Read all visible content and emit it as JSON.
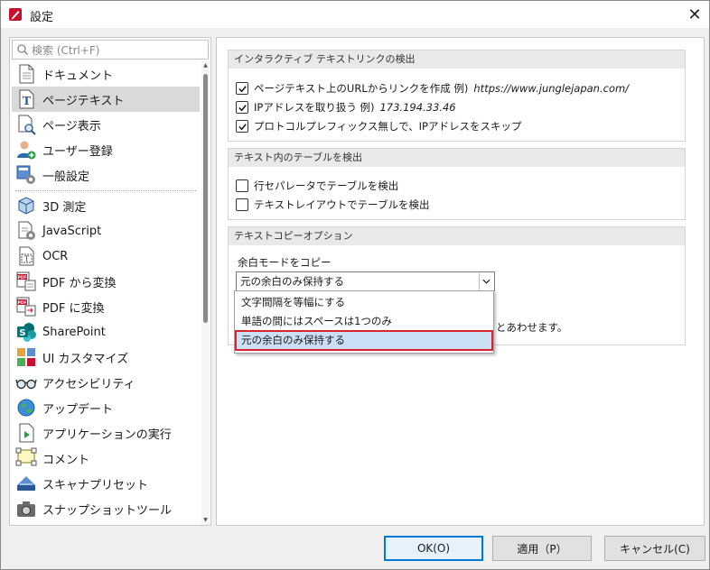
{
  "window": {
    "title": "設定",
    "close_glyph": "✕"
  },
  "search": {
    "placeholder": "検索 (Ctrl+F)"
  },
  "nav": {
    "items": [
      {
        "label": "ドキュメント",
        "icon": "document-icon"
      },
      {
        "label": "ページテキスト",
        "icon": "text-icon",
        "selected": true
      },
      {
        "label": "ページ表示",
        "icon": "page-view-icon"
      },
      {
        "label": "ユーザー登録",
        "icon": "user-add-icon"
      },
      {
        "label": "一般設定",
        "icon": "general-settings-icon"
      },
      {
        "label": "3D 測定",
        "icon": "cube-icon"
      },
      {
        "label": "JavaScript",
        "icon": "script-gear-icon"
      },
      {
        "label": "OCR",
        "icon": "ocr-icon"
      },
      {
        "label": "PDF から変換",
        "icon": "pdf-convert-from-icon"
      },
      {
        "label": "PDF に変換",
        "icon": "pdf-convert-to-icon"
      },
      {
        "label": "SharePoint",
        "icon": "sharepoint-icon"
      },
      {
        "label": "UI カスタマイズ",
        "icon": "ui-customize-icon"
      },
      {
        "label": "アクセシビリティ",
        "icon": "glasses-icon"
      },
      {
        "label": "アップデート",
        "icon": "globe-icon"
      },
      {
        "label": "アプリケーションの実行",
        "icon": "app-run-icon"
      },
      {
        "label": "コメント",
        "icon": "comment-icon"
      },
      {
        "label": "スキャナプリセット",
        "icon": "scanner-icon"
      },
      {
        "label": "スナップショットツール",
        "icon": "camera-icon"
      }
    ]
  },
  "groups": {
    "links": {
      "header": "インタラクティブ テキストリンクの検出",
      "options": [
        {
          "label": "ページテキスト上のURLからリンクを作成  例)",
          "example": "https://www.junglejapan.com/",
          "checked": true
        },
        {
          "label": "IPアドレスを取り扱う 例)",
          "example": "173.194.33.46",
          "checked": true
        },
        {
          "label": "プロトコルプレフィックス無しで、IPアドレスをスキップ",
          "example": "",
          "checked": true
        }
      ]
    },
    "tables": {
      "header": "テキスト内のテーブルを検出",
      "options": [
        {
          "label": "行セパレータでテーブルを検出",
          "checked": false
        },
        {
          "label": "テキストレイアウトでテーブルを検出",
          "checked": false
        }
      ]
    },
    "copy": {
      "header": "テキストコピーオプション",
      "whitespace_label": "余白モードをコピー",
      "selected_value": "元の余白のみ保持する",
      "desc_tail": "とあわせます。",
      "dropdown_options": [
        "文字間隔を等幅にする",
        "単語の間にはスペースは1つのみ",
        "元の余白のみ保持する"
      ]
    }
  },
  "buttons": {
    "ok": "OK(O)",
    "apply": "適用（P）",
    "cancel": "キャンセル(C)"
  },
  "colors": {
    "accent": "#0078d7",
    "highlight_border": "#d9232e",
    "selection": "#cce0f5"
  }
}
